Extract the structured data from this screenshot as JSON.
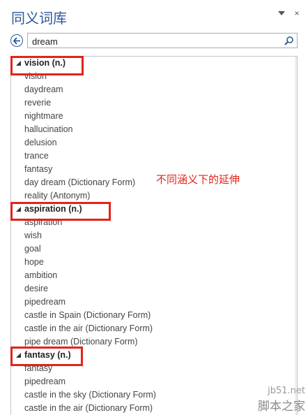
{
  "pane": {
    "title": "同义词库",
    "controls": {
      "dropdown": "dropdown-arrow",
      "close": "×"
    }
  },
  "search": {
    "value": "dream",
    "icon": "search-icon",
    "back_icon": "back-arrow-icon"
  },
  "groups": [
    {
      "header": "vision (n.)",
      "items": [
        "vision",
        "daydream",
        "reverie",
        "nightmare",
        "hallucination",
        "delusion",
        "trance",
        "fantasy",
        "day dream (Dictionary Form)",
        "reality (Antonym)"
      ]
    },
    {
      "header": "aspiration (n.)",
      "items": [
        "aspiration",
        "wish",
        "goal",
        "hope",
        "ambition",
        "desire",
        "pipedream",
        "castle in Spain (Dictionary Form)",
        "castle in the air (Dictionary Form)",
        "pipe dream (Dictionary Form)"
      ]
    },
    {
      "header": "fantasy (n.)",
      "items": [
        "fantasy",
        "pipedream",
        "castle in the sky (Dictionary Form)",
        "castle in the air (Dictionary Form)"
      ]
    }
  ],
  "annotation": "不同涵义下的延伸",
  "watermark": {
    "line1": "jb51.net",
    "line2": "脚本之家"
  },
  "colors": {
    "accent": "#2b579a",
    "highlight": "#e3231b"
  }
}
